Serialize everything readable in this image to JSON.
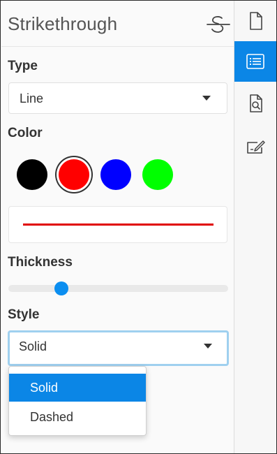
{
  "panel": {
    "title": "Strikethrough",
    "header_icon": "strikethrough-icon"
  },
  "type_section": {
    "label": "Type",
    "selected": "Line"
  },
  "color_section": {
    "label": "Color",
    "swatches": [
      {
        "name": "black",
        "color": "#000000"
      },
      {
        "name": "red",
        "color": "#ff0000",
        "selected": true
      },
      {
        "name": "blue",
        "color": "#0000ff"
      },
      {
        "name": "green",
        "color": "#00ff00"
      }
    ],
    "preview_color": "#e00000"
  },
  "thickness_section": {
    "label": "Thickness",
    "value_fraction": 0.24
  },
  "style_section": {
    "label": "Style",
    "selected": "Solid",
    "options": [
      "Solid",
      "Dashed"
    ],
    "highlighted_option": "Solid"
  },
  "toolbar": {
    "items": [
      {
        "icon": "page-icon"
      },
      {
        "icon": "list-icon",
        "active": true
      },
      {
        "icon": "search-document-icon"
      },
      {
        "icon": "signature-icon"
      }
    ],
    "accent": "#0b86e6"
  }
}
